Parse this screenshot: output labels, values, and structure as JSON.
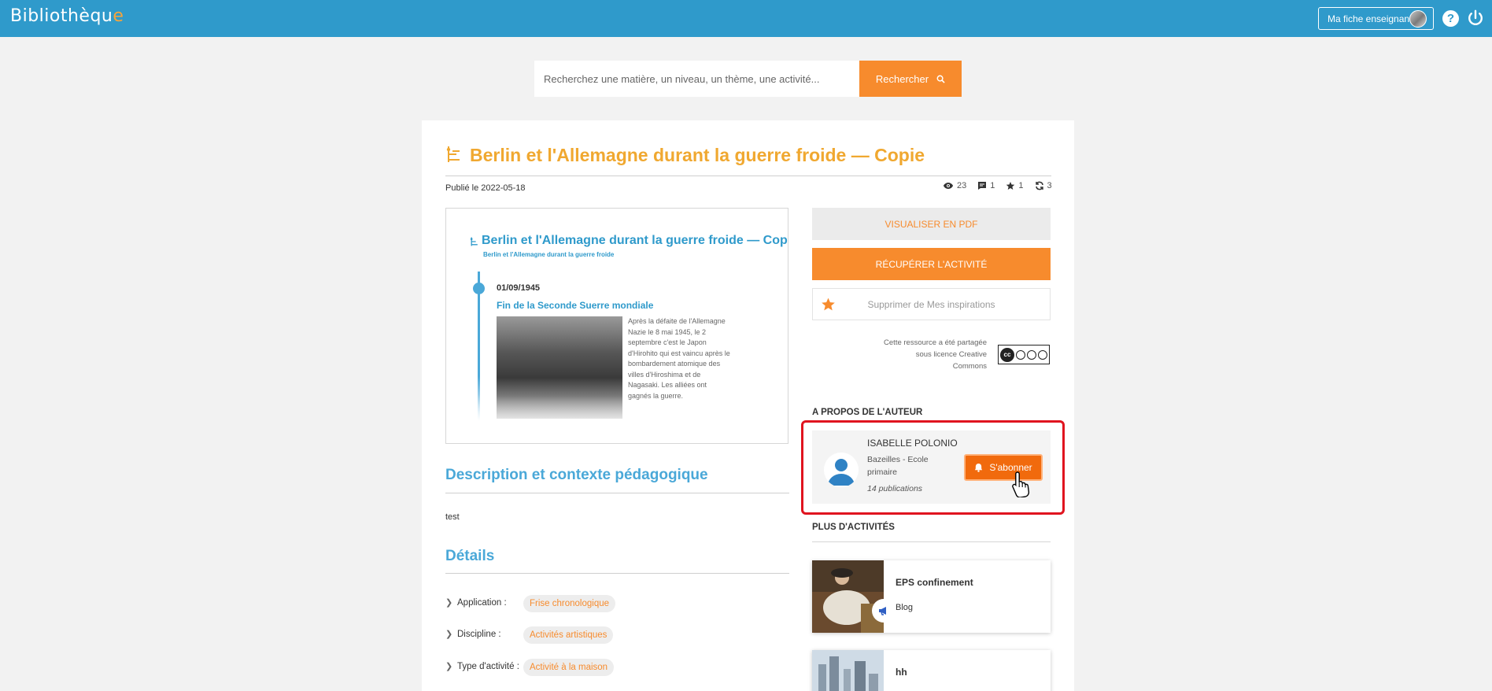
{
  "header": {
    "logo_main": "Bibliothèqu",
    "logo_accent": "e",
    "teacher_button": "Ma fiche enseignant",
    "help_glyph": "?"
  },
  "search": {
    "placeholder": "Recherchez une matière, un niveau, un thème, une activité...",
    "button_label": "Rechercher"
  },
  "activity": {
    "title": "Berlin et l'Allemagne durant la guerre froide — Copie",
    "published": "Publié le 2022-05-18",
    "stats": {
      "views": "23",
      "comments": "1",
      "stars": "1",
      "reuses": "3"
    }
  },
  "preview": {
    "title": "Berlin et l'Allemagne durant la guerre froide — Copie",
    "subtitle": "Berlin et l'Allemagne durant la guerre froide",
    "date": "01/09/1945",
    "event": "Fin de la Seconde Suerre mondiale",
    "text": "Après la défaite de l'Allemagne Nazie le 8 mai 1945, le 2 septembre c'est le Japon d'Hirohito qui est vaincu après le bombardement atomique des villes d'Hiroshima et de Nagasaki. Les alliées ont gagnés la guerre."
  },
  "actions": {
    "pdf": "VISUALISER EN PDF",
    "get": "RÉCUPÉRER L'ACTIVITÉ",
    "favorite": "Supprimer de Mes inspirations"
  },
  "license": {
    "text": "Cette ressource a été partagée sous licence Creative Commons",
    "badge": "cc"
  },
  "author": {
    "section": "A PROPOS DE L'AUTEUR",
    "name": "ISABELLE POLONIO",
    "school": "Bazeilles - Ecole primaire",
    "publications": "14 publications",
    "subscribe": "S'abonner"
  },
  "more": {
    "section": "PLUS D'ACTIVITÉS",
    "items": [
      {
        "title": "EPS confinement",
        "type": "Blog"
      },
      {
        "title": "hh"
      }
    ]
  },
  "description": {
    "heading": "Description et contexte pédagogique",
    "text": "test"
  },
  "details": {
    "heading": "Détails",
    "rows": [
      {
        "label": "Application :",
        "value": "Frise chronologique"
      },
      {
        "label": "Discipline :",
        "value": "Activités artistiques"
      },
      {
        "label": "Type d'activité :",
        "value": "Activité à la maison"
      }
    ]
  },
  "colors": {
    "header": "#2f9acb",
    "accent_orange": "#f78b2d",
    "title_gold": "#f0a830",
    "highlight_red": "#e0141f"
  }
}
